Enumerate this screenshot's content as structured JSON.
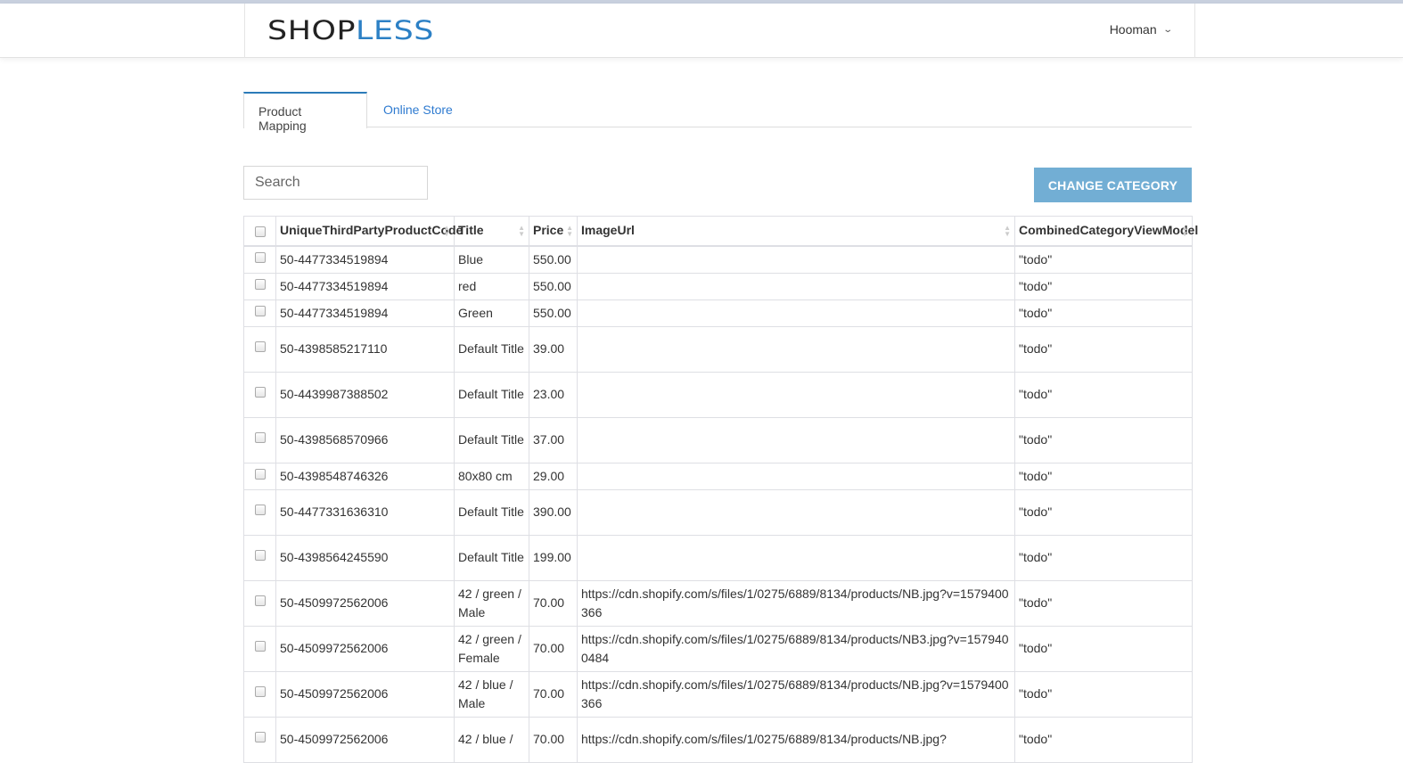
{
  "header": {
    "logo_part1": "SHOP",
    "logo_part2": "LESS",
    "user_name": "Hooman",
    "user_menu_icon": "chevron-down-icon",
    "accent_color": "#2c80c5"
  },
  "tabs": [
    {
      "label": "Product Mapping",
      "active": true
    },
    {
      "label": "Online Store",
      "active": false
    }
  ],
  "search": {
    "placeholder": "Search",
    "value": ""
  },
  "toolbar": {
    "change_category_label": "CHANGE CATEGORY",
    "button_color": "#72aed4"
  },
  "table": {
    "columns": [
      {
        "label": "UniqueThirdPartyProductCode",
        "sortable": true
      },
      {
        "label": "Title",
        "sortable": true
      },
      {
        "label": "Price",
        "sortable": true
      },
      {
        "label": "ImageUrl",
        "sortable": true
      },
      {
        "label": "CombinedCategoryViewModel",
        "sortable": true
      }
    ],
    "rows": [
      {
        "code": "50-4477334519894",
        "title": "Blue",
        "price": "550.00",
        "image_url": "",
        "category": "\"todo\""
      },
      {
        "code": "50-4477334519894",
        "title": "red",
        "price": "550.00",
        "image_url": "",
        "category": "\"todo\""
      },
      {
        "code": "50-4477334519894",
        "title": "Green",
        "price": "550.00",
        "image_url": "",
        "category": "\"todo\""
      },
      {
        "code": "50-4398585217110",
        "title": "Default Title",
        "price": "39.00",
        "image_url": "",
        "category": "\"todo\""
      },
      {
        "code": "50-4439987388502",
        "title": "Default Title",
        "price": "23.00",
        "image_url": "",
        "category": "\"todo\""
      },
      {
        "code": "50-4398568570966",
        "title": "Default Title",
        "price": "37.00",
        "image_url": "",
        "category": "\"todo\""
      },
      {
        "code": "50-4398548746326",
        "title": "80x80 cm",
        "price": "29.00",
        "image_url": "",
        "category": "\"todo\""
      },
      {
        "code": "50-4477331636310",
        "title": "Default Title",
        "price": "390.00",
        "image_url": "",
        "category": "\"todo\""
      },
      {
        "code": "50-4398564245590",
        "title": "Default Title",
        "price": "199.00",
        "image_url": "",
        "category": "\"todo\""
      },
      {
        "code": "50-4509972562006",
        "title": "42 / green / Male",
        "price": "70.00",
        "image_url": "https://cdn.shopify.com/s/files/1/0275/6889/8134/products/NB.jpg?v=1579400366",
        "category": "\"todo\""
      },
      {
        "code": "50-4509972562006",
        "title": "42 / green / Female",
        "price": "70.00",
        "image_url": "https://cdn.shopify.com/s/files/1/0275/6889/8134/products/NB3.jpg?v=1579400484",
        "category": "\"todo\""
      },
      {
        "code": "50-4509972562006",
        "title": "42 / blue / Male",
        "price": "70.00",
        "image_url": "https://cdn.shopify.com/s/files/1/0275/6889/8134/products/NB.jpg?v=1579400366",
        "category": "\"todo\""
      },
      {
        "code": "50-4509972562006",
        "title": "42 / blue / ",
        "price": "70.00",
        "image_url": "https://cdn.shopify.com/s/files/1/0275/6889/8134/products/NB.jpg?",
        "category": "\"todo\""
      }
    ]
  }
}
